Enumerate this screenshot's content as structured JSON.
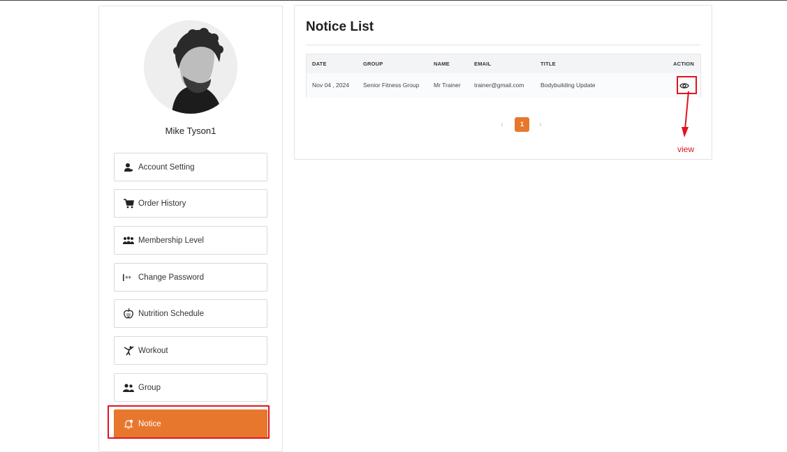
{
  "profile": {
    "name": "Mike Tyson1"
  },
  "sidebar": {
    "items": [
      {
        "label": "Account Setting",
        "icon": "user-gear-icon"
      },
      {
        "label": "Order History",
        "icon": "cart-icon"
      },
      {
        "label": "Membership Level",
        "icon": "people-group-icon"
      },
      {
        "label": "Change Password",
        "icon": "password-icon"
      },
      {
        "label": "Nutrition Schedule",
        "icon": "apple-icon"
      },
      {
        "label": "Workout",
        "icon": "martial-arts-icon"
      },
      {
        "label": "Group",
        "icon": "users-icon"
      },
      {
        "label": "Notice",
        "icon": "bell-icon",
        "active": true
      }
    ]
  },
  "main": {
    "title": "Notice List",
    "table": {
      "headers": [
        "DATE",
        "GROUP",
        "NAME",
        "EMAIL",
        "TITLE",
        "ACTION"
      ],
      "rows": [
        {
          "date": "Nov 04 , 2024",
          "group": "Senior Fitness Group",
          "name": "Mr Trainer",
          "email": "trainer@gmail.com",
          "title": "Bodybuilding Update",
          "action_icon": "eye-icon"
        }
      ]
    },
    "pagination": {
      "prev": "‹",
      "current": "1",
      "next": "›"
    }
  },
  "annotation": {
    "label": "view"
  },
  "colors": {
    "accent": "#e8772e",
    "annotation": "#e0141e"
  }
}
